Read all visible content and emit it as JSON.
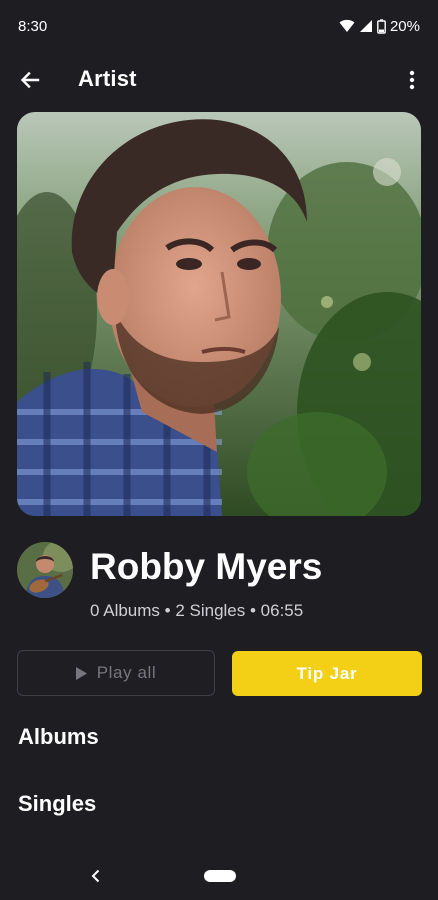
{
  "status_bar": {
    "time": "8:30",
    "battery": "20%",
    "icons": [
      "wifi-icon",
      "signal-icon",
      "battery-icon"
    ]
  },
  "app_bar": {
    "title": "Artist",
    "back_icon": "arrow-left-icon",
    "more_icon": "more-vert-icon"
  },
  "artist": {
    "name": "Robby Myers",
    "meta": "0 Albums • 2 Singles • 06:55"
  },
  "actions": {
    "play_all_label": "Play all",
    "tip_jar_label": "Tip Jar"
  },
  "sections": {
    "albums": "Albums",
    "singles": "Singles"
  },
  "colors": {
    "background": "#1e1d22",
    "accent": "#f3cf16",
    "text_primary": "#ffffff",
    "text_secondary": "#cfcfd4",
    "disabled": "#77767c"
  }
}
